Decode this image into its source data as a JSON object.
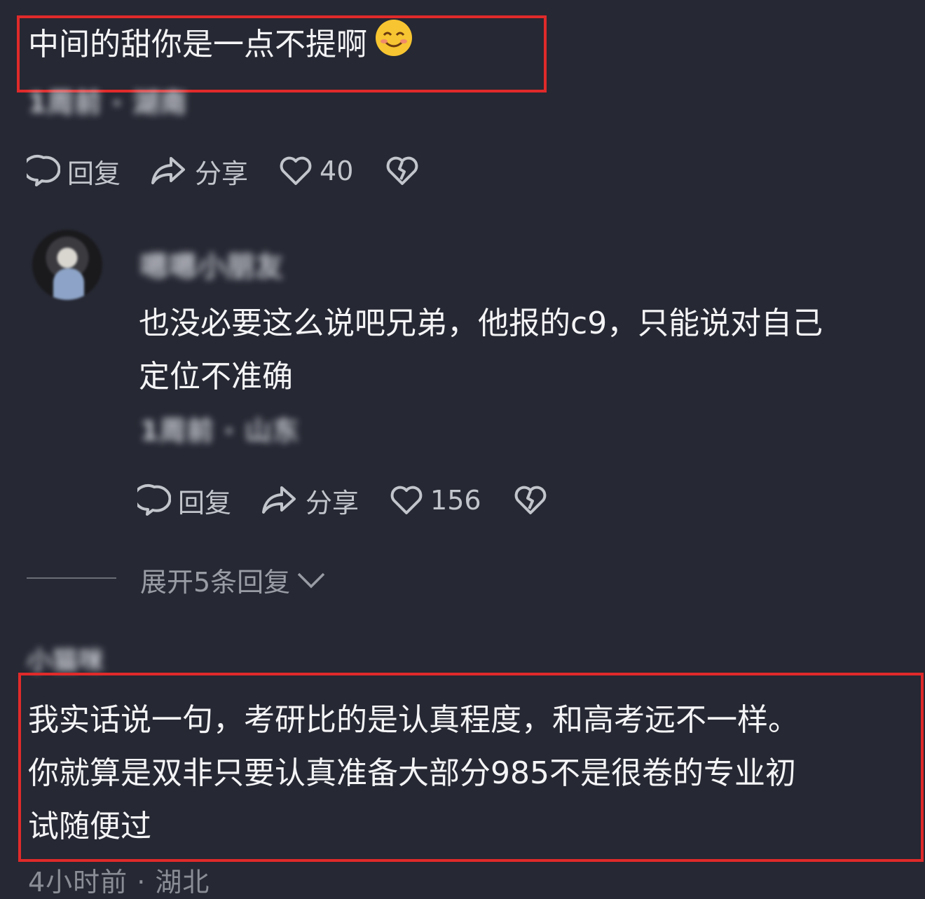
{
  "comment1": {
    "text": "中间的甜你是一点不提啊",
    "emoji": "smiling-face-icon",
    "meta": "1周前 · 湖南",
    "actions": {
      "reply": "回复",
      "share": "分享",
      "likes": "40"
    }
  },
  "reply1": {
    "username": "嗯嗯小朋友",
    "text_line1": "也没必要这么说吧兄弟，他报的c9，只能说对自己",
    "text_line2": "定位不准确",
    "meta": "1周前 · 山东",
    "actions": {
      "reply": "回复",
      "share": "分享",
      "likes": "156"
    },
    "expand_label": "展开5条回复"
  },
  "comment2": {
    "username": "小猫咪",
    "text_line1": "我实话说一句，考研比的是认真程度，和高考远不一样。",
    "text_line2": "你就算是双非只要认真准备大部分985不是很卷的专业初",
    "text_line3": "试随便过",
    "meta": "4小时前 · 湖北"
  },
  "colors": {
    "background": "#262833",
    "highlight": "#e02a2a",
    "text": "#f4f4f6",
    "muted": "#8b8d96"
  }
}
